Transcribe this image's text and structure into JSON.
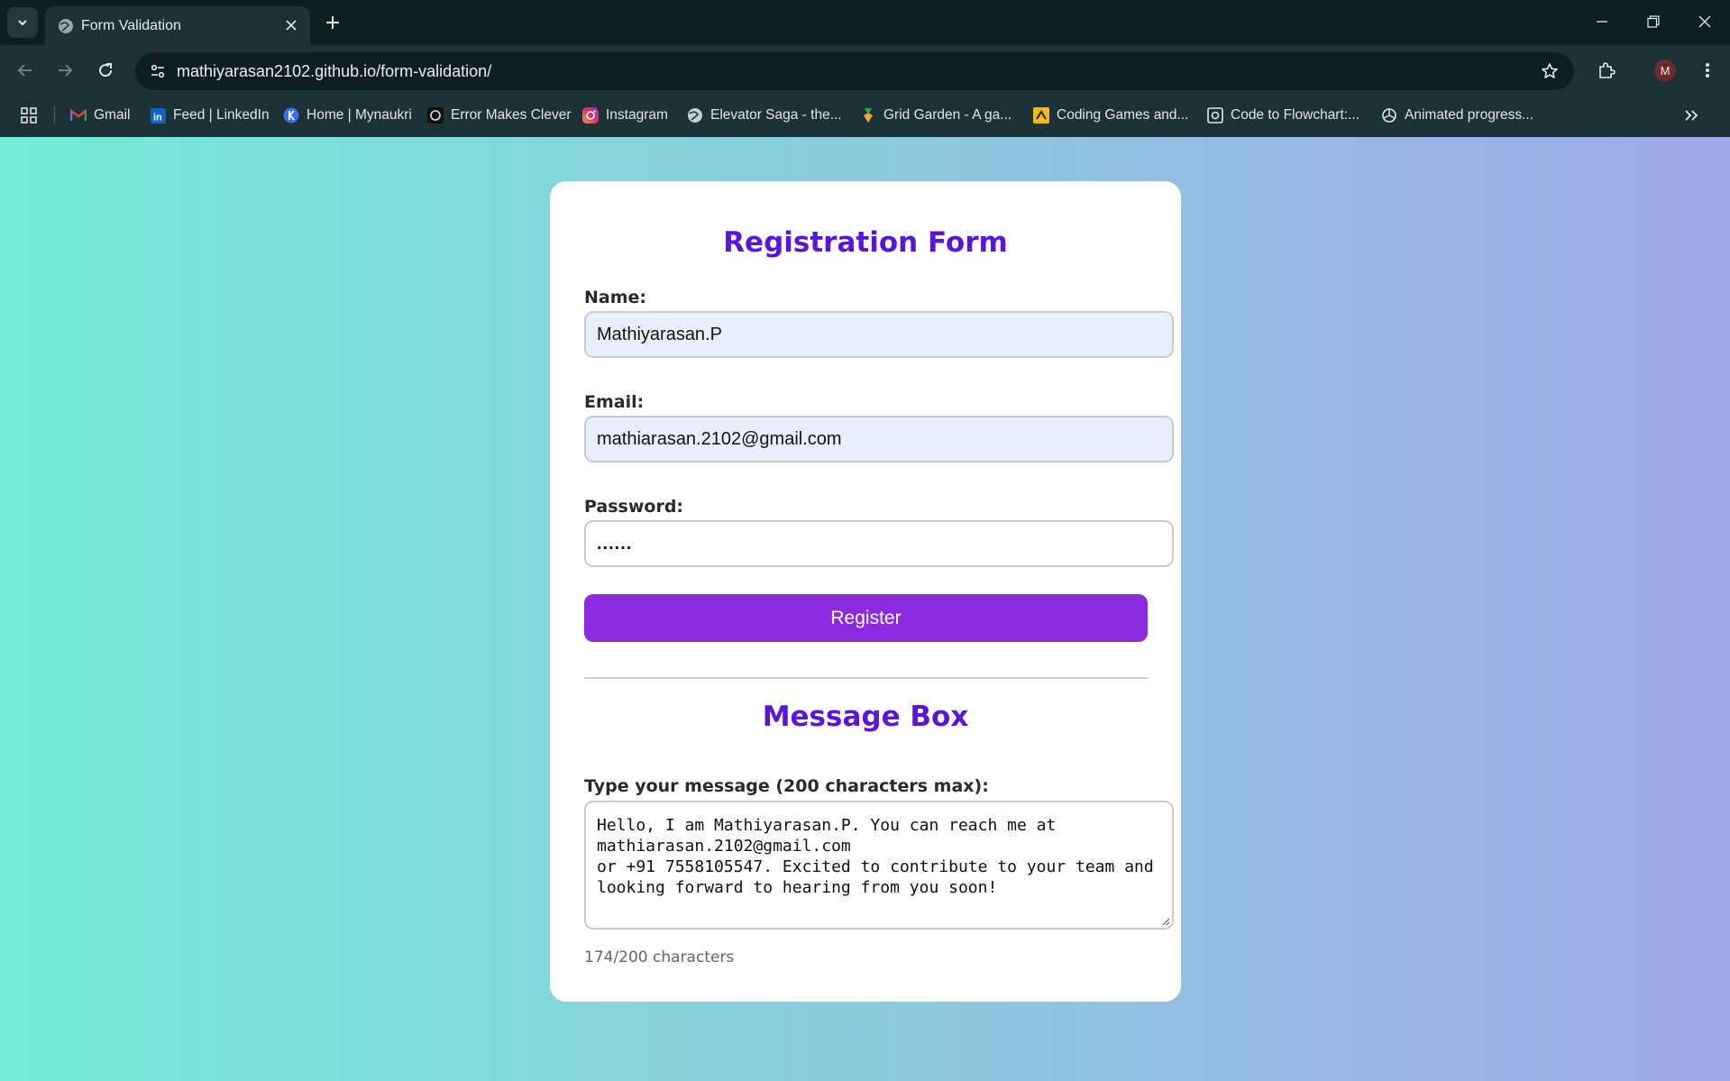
{
  "browser": {
    "tab_title": "Form Validation",
    "url": "mathiyarasan2102.github.io/form-validation/",
    "profile_initial": "M",
    "bookmarks": [
      {
        "label": "Gmail",
        "icon": "gmail-icon"
      },
      {
        "label": "Feed | LinkedIn",
        "icon": "linkedin-icon"
      },
      {
        "label": "Home | Mynaukri",
        "icon": "naukri-icon"
      },
      {
        "label": "Error Makes Clever",
        "icon": "emc-icon"
      },
      {
        "label": "Instagram",
        "icon": "instagram-icon"
      },
      {
        "label": "Elevator Saga - the...",
        "icon": "globe-icon"
      },
      {
        "label": "Grid Garden - A ga...",
        "icon": "carrot-icon"
      },
      {
        "label": "Coding Games and...",
        "icon": "codingame-icon"
      },
      {
        "label": "Code to Flowchart:...",
        "icon": "flowchart-icon"
      },
      {
        "label": "Animated progress...",
        "icon": "openai-icon"
      }
    ]
  },
  "form": {
    "title": "Registration Form",
    "name_label": "Name:",
    "name_value": "Mathiyarasan.P",
    "email_label": "Email:",
    "email_value": "mathiarasan.2102@gmail.com",
    "password_label": "Password:",
    "password_value": "......",
    "register_label": "Register"
  },
  "message_box": {
    "title": "Message Box",
    "label": "Type your message (200 characters max):",
    "message_value": "Hello, I am Mathiyarasan.P. You can reach me at mathiarasan.2102@gmail.com\nor +91 7558105547. Excited to contribute to your team and looking forward to hearing from you soon!",
    "counter": "174/200 characters"
  },
  "colors": {
    "accent": "#8a2be2",
    "heading": "#5a16d6",
    "gradient_start": "#73ecd6",
    "gradient_end": "#a0a8e8"
  }
}
